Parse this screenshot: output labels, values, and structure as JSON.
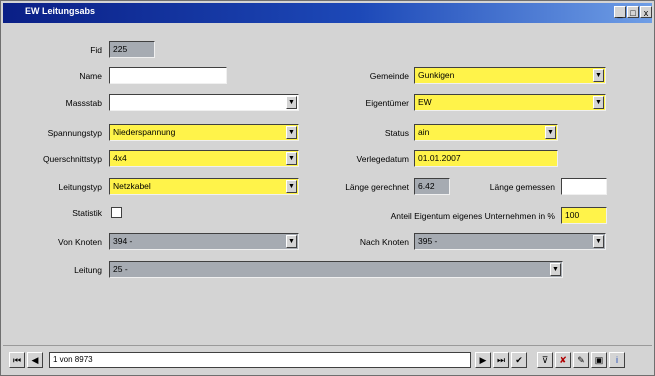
{
  "window": {
    "title": "EW Leitungsabs",
    "buttons": [
      "_",
      "□",
      "x"
    ]
  },
  "form": {
    "fid": {
      "label": "Fid",
      "value": "225"
    },
    "name": {
      "label": "Name",
      "value": ""
    },
    "massstab": {
      "label": "Massstab",
      "value": ""
    },
    "spannungstyp": {
      "label": "Spannungstyp",
      "value": "Niederspannung"
    },
    "querschnittstyp": {
      "label": "Querschnittstyp",
      "value": "4x4"
    },
    "leitungstyp": {
      "label": "Leitungstyp",
      "value": "Netzkabel"
    },
    "statistik": {
      "label": "Statistik"
    },
    "von_knoten": {
      "label": "Von Knoten",
      "value": "394 -"
    },
    "gemeinde": {
      "label": "Gemeinde",
      "value": "Gunkigen"
    },
    "eigentuemer": {
      "label": "Eigentümer",
      "value": "EW"
    },
    "status": {
      "label": "Status",
      "value": "ain"
    },
    "verlegedatum": {
      "label": "Verlegedatum",
      "value": "01.01.2007"
    },
    "laenge_gerechnet": {
      "label": "Länge gerechnet",
      "value": "6.42"
    },
    "laenge_gemessen": {
      "label": "Länge gemessen",
      "value": ""
    },
    "anteil": {
      "label": "Anteil Eigentum eigenes Unternehmen in %",
      "value": "100"
    },
    "nach_knoten": {
      "label": "Nach Knoten",
      "value": "395 -"
    },
    "leitung": {
      "label": "Leitung",
      "value": "25 -"
    }
  },
  "navigation": {
    "record": "1 von 8973"
  },
  "colors": {
    "required": "#fff34a",
    "readonly": "#a6abb2",
    "titlebar": "#0a1f86"
  }
}
